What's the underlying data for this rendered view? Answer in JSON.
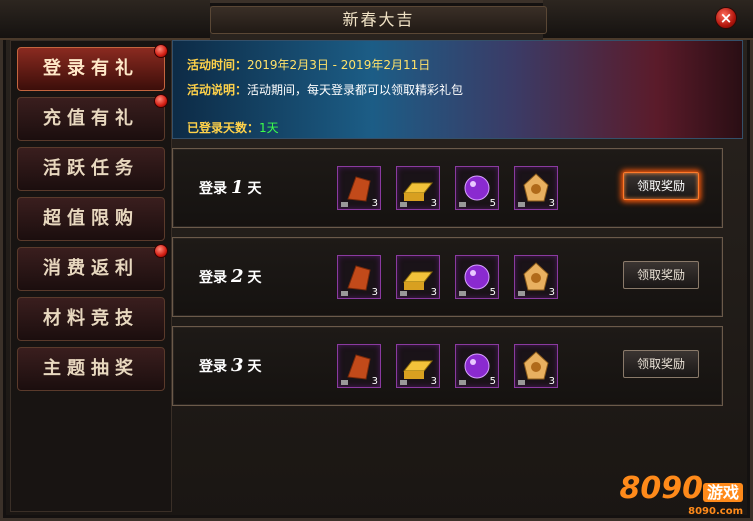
{
  "window": {
    "title": "新春大吉"
  },
  "sidebar": {
    "items": [
      {
        "label": "登录有礼",
        "active": true,
        "badge": true
      },
      {
        "label": "充值有礼",
        "active": false,
        "badge": true
      },
      {
        "label": "活跃任务",
        "active": false,
        "badge": false
      },
      {
        "label": "超值限购",
        "active": false,
        "badge": false
      },
      {
        "label": "消费返利",
        "active": false,
        "badge": true
      },
      {
        "label": "材料竞技",
        "active": false,
        "badge": false
      },
      {
        "label": "主题抽奖",
        "active": false,
        "badge": false
      }
    ]
  },
  "banner": {
    "time_label": "活动时间：",
    "time_value": "2019年2月3日 - 2019年2月11日",
    "desc_label": "活动说明：",
    "desc_value": "活动期间，每天登录都可以领取精彩礼包",
    "days_label": "已登录天数：",
    "days_value": "1天"
  },
  "rewards": [
    {
      "prefix": "登录",
      "day": "1",
      "suffix": "天",
      "items": [
        {
          "icon": "armor-shard-icon",
          "count": "3"
        },
        {
          "icon": "gold-bar-icon",
          "count": "3"
        },
        {
          "icon": "purple-orb-icon",
          "count": "5"
        },
        {
          "icon": "token-icon",
          "count": "3"
        }
      ],
      "button": "领取奖励",
      "active": true
    },
    {
      "prefix": "登录",
      "day": "2",
      "suffix": "天",
      "items": [
        {
          "icon": "armor-shard-icon",
          "count": "3"
        },
        {
          "icon": "gold-bar-icon",
          "count": "3"
        },
        {
          "icon": "purple-orb-icon",
          "count": "5"
        },
        {
          "icon": "token-icon",
          "count": "3"
        }
      ],
      "button": "领取奖励",
      "active": false
    },
    {
      "prefix": "登录",
      "day": "3",
      "suffix": "天",
      "items": [
        {
          "icon": "armor-shard-icon",
          "count": "3"
        },
        {
          "icon": "gold-bar-icon",
          "count": "3"
        },
        {
          "icon": "purple-orb-icon",
          "count": "5"
        },
        {
          "icon": "token-icon",
          "count": "3"
        }
      ],
      "button": "领取奖励",
      "active": false
    }
  ],
  "watermark": {
    "number": "8090",
    "word": "游戏",
    "domain": "8090.com"
  },
  "colors": {
    "accent": "#ff7a2a",
    "highlight": "#ffd24a",
    "green": "#3bff4a",
    "badge": "#d21d12"
  }
}
